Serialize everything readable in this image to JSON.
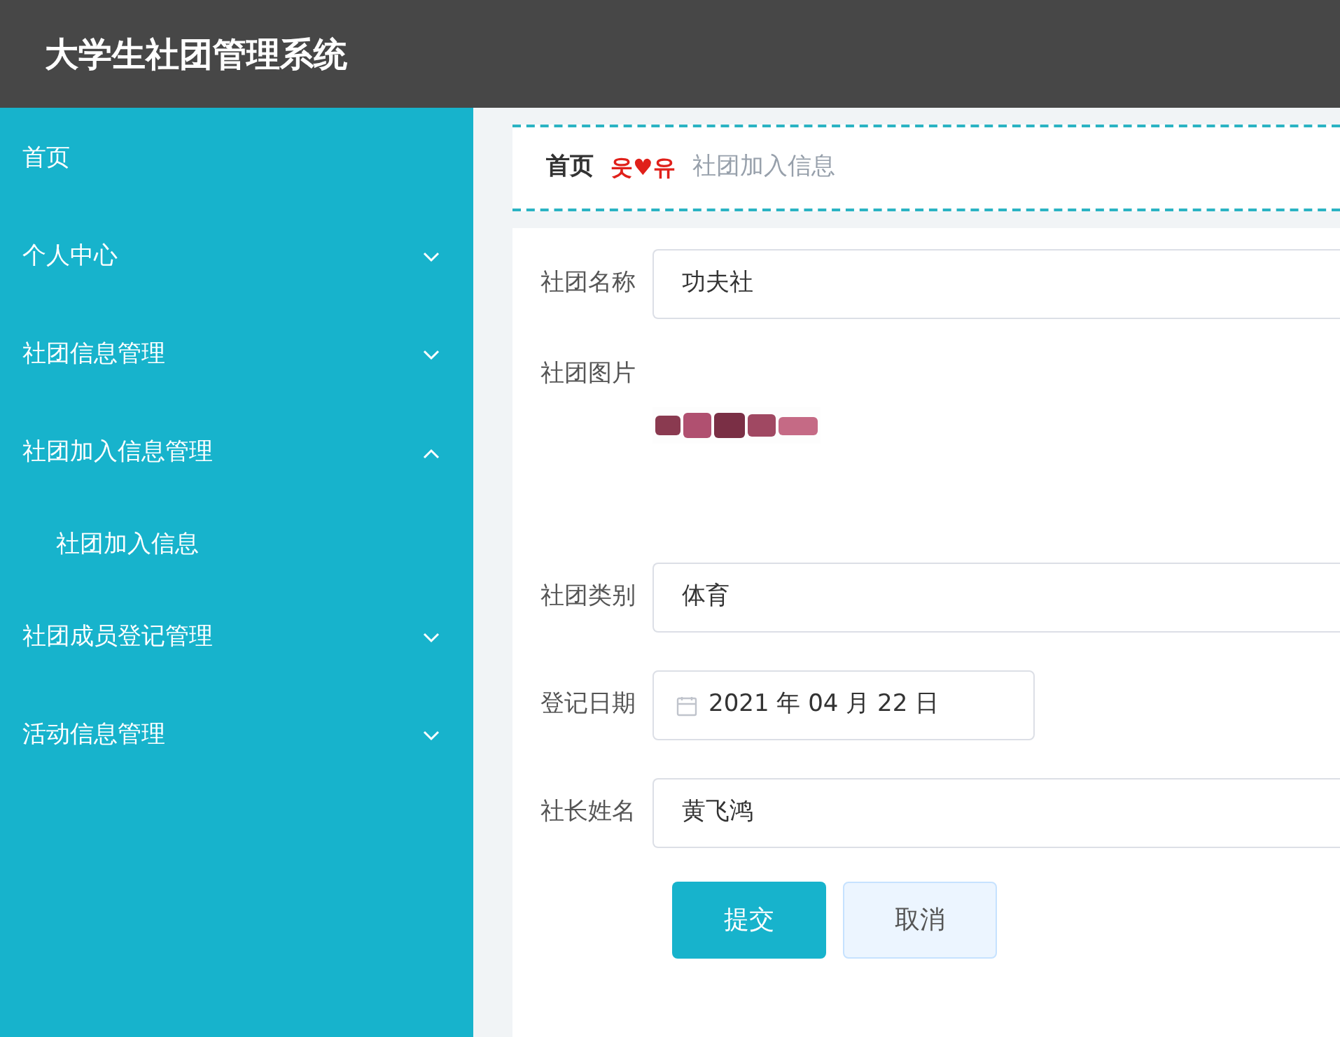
{
  "header": {
    "title": "大学生社团管理系统"
  },
  "sidebar": {
    "items": [
      {
        "kind": "link",
        "label": "首页"
      },
      {
        "kind": "group",
        "label": "个人中心",
        "expanded": false
      },
      {
        "kind": "group",
        "label": "社团信息管理",
        "expanded": false
      },
      {
        "kind": "group",
        "label": "社团加入信息管理",
        "expanded": true,
        "children": [
          {
            "label": "社团加入信息"
          }
        ]
      },
      {
        "kind": "group",
        "label": "社团成员登记管理",
        "expanded": false
      },
      {
        "kind": "group",
        "label": "活动信息管理",
        "expanded": false
      }
    ]
  },
  "breadcrumb": {
    "home": "首页",
    "separator": "웃♥유",
    "current": "社团加入信息"
  },
  "form": {
    "fields": [
      {
        "kind": "text",
        "label": "社团名称",
        "value": "功夫社"
      },
      {
        "label": "社团图片"
      },
      {
        "kind": "text",
        "label": "社团类别",
        "value": "体育"
      },
      {
        "kind": "date",
        "label": "登记日期",
        "value": "2021 年 04 月 22 日"
      },
      {
        "kind": "text",
        "label": "社长姓名",
        "value": "黄飞鸿"
      }
    ],
    "buttons": [
      {
        "kind": "primary",
        "label": "提交"
      },
      {
        "kind": "secondary",
        "label": "取消"
      }
    ]
  }
}
